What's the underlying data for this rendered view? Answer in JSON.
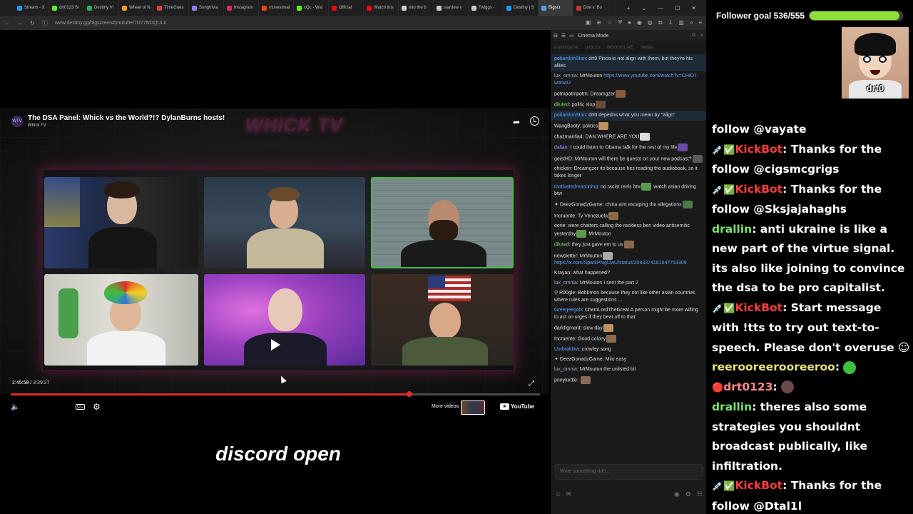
{
  "tabs": [
    {
      "label": "Stream - X",
      "color": "#1d9bf0"
    },
    {
      "label": "drt0123 St",
      "color": "#53fc18"
    },
    {
      "label": "Destiny Vi",
      "color": "#1db954"
    },
    {
      "label": "Wheel of N",
      "color": "#f0a020"
    },
    {
      "label": "TimeGues",
      "color": "#e04040"
    },
    {
      "label": "Songtrivia",
      "color": "#8a7fff"
    },
    {
      "label": "Instagram",
      "color": "#d62976"
    },
    {
      "label": "r/Livestreal",
      "color": "#ff4500"
    },
    {
      "label": "xQc - Wat",
      "color": "#53fc18"
    },
    {
      "label": "Official",
      "color": "#ff0000"
    },
    {
      "label": "Watch this",
      "color": "#ff0000"
    },
    {
      "label": "into the b",
      "color": "#cccccc"
    },
    {
      "label": "stardew v",
      "color": "#cccccc"
    },
    {
      "label": "Twiggs -",
      "color": "#cccccc"
    },
    {
      "label": "Destiny | S",
      "color": "#1d9bf0"
    },
    {
      "label": "Bigscr",
      "color": "#5aa0ff"
    },
    {
      "label": "Doe v. Bo",
      "color": "#cc3333"
    }
  ],
  "active_tab_index": 15,
  "address": {
    "url": "www.destiny.gg/bigscreen#youtube/7iJ77NOQULk"
  },
  "video": {
    "title": "The DSA Panel: Whick vs the World?!? DylanBurns hosts!",
    "channel": "Whick TV",
    "channel_avatar_text": "WTV",
    "logo_text": "WHICK TV",
    "time_current": "2:45:58",
    "time_separator": "/",
    "time_total": "3:39:27",
    "progress_fraction": 0.754,
    "more_videos_label": "More videos",
    "youtube_label": "YouTube"
  },
  "subtitle_text": "discord open",
  "chat": {
    "header_label": "Cinema Mode",
    "pinned": [
      "anythingelse",
      "drt0123",
      "MOOOOLIVE",
      "Viebax"
    ],
    "input_placeholder": "Write something drt0...",
    "messages": [
      {
        "user": "potiamkinStan",
        "user_color": "#5aa0ff",
        "text": "drt0 Pisco is not align with them, but they're his allies",
        "highlight": true
      },
      {
        "user": "lux_omnia",
        "user_color": "#9bb0c8",
        "text": "MrMouton",
        "link": "https://www.youtube.com/watch?v=CHID7-wdowU"
      },
      {
        "user": "potmpotmpotm",
        "user_color": "#ddd",
        "text": "Dreamgzer",
        "emote": "#8a5a3a"
      },
      {
        "user": "diluted",
        "user_color": "#7de06a",
        "text": "politic slop",
        "emote": "#6a4a3a"
      },
      {
        "user": "potiamkinStan",
        "user_color": "#5aa0ff",
        "text": "drt0 depedns what you mean by \"align\"",
        "highlight": true
      },
      {
        "user": "WangBooty",
        "user_color": "#ddd",
        "text": "politics",
        "emote": "#c09060"
      },
      {
        "user": "chazmantia4",
        "user_color": "#ddd",
        "text": "DAN WHERE ARE YOU",
        "emote": "#dddddd"
      },
      {
        "user": "dalian",
        "user_color": "#b08aff",
        "text": "I could listen to Obama talk for the rest of my life",
        "emote": "#6a4aaa"
      },
      {
        "user": "geistHD",
        "user_color": "#ddd",
        "text": "MrMouton will there be guests on your new podcast?",
        "emote": "#5a5a5a"
      },
      {
        "user": "chicken",
        "user_color": "#ddd",
        "text": "Dreamgzer its because hes reading the audiobook, so it takes longer"
      },
      {
        "user": "motivatedreasoning",
        "user_color": "#5aa0ff",
        "text": "no racist reels btw",
        "emote": "#5a9a4a",
        "text2": "watch asian driving btw"
      },
      {
        "user": "DeezGonadzGame",
        "user_color": "#ddd",
        "text": "china aint escaping the allegations",
        "emote": "#4a7a4a",
        "badge": "✦"
      },
      {
        "user": "Incruente",
        "user_color": "#ddd",
        "text": "Ty Venezuela",
        "emote": "#8a6a4a"
      },
      {
        "user": "eerie",
        "user_color": "#ddd",
        "text": "were chatters calling the reckless ben video antisemitic yesterday",
        "emote": "#5a9a4a",
        "text2": "MrMouton"
      },
      {
        "user": "diluted",
        "user_color": "#7de06a",
        "text": "they just gave em to us",
        "emote": "#8a6a4a"
      },
      {
        "user": "newsletter",
        "user_color": "#ddd",
        "text": "MrMouton",
        "emote": "#aaaaaa",
        "link": "https://x.com/SparkPlugUwU/status/2093374181647753309"
      },
      {
        "user": "Krayan",
        "user_color": "#ddd",
        "text": "what happened?"
      },
      {
        "user": "lux_omnia",
        "user_color": "#9bb0c8",
        "text": "MrMouton I sent the part 2"
      },
      {
        "user": "R00gle",
        "user_color": "#ddd",
        "text": "Bobbmon because they not like other asian countries where rules are suggestions ...",
        "badge": "⚲"
      },
      {
        "user": "Greegeegob",
        "user_color": "#5aa0ff",
        "text": "ChemLordTheGreat A person might be more willing to act on urges if they beat off to that"
      },
      {
        "user": "darkfigment",
        "user_color": "#ddd",
        "text": "slow day",
        "emote": "#c09060"
      },
      {
        "user": "Incruente",
        "user_color": "#ddd",
        "text": "Good colony",
        "emote": "#8a6a4a"
      },
      {
        "user": "Umbraklaw",
        "user_color": "#5aa0ff",
        "text": "crowley song"
      },
      {
        "user": "DeezGonadzGame",
        "user_color": "#ddd",
        "text": "Milo easy",
        "badge": "✦"
      },
      {
        "user": "lux_omnia",
        "user_color": "#9bb0c8",
        "text": "MrMouton the unlisted bit"
      },
      {
        "user": "pnnykettle",
        "user_color": "#ddd",
        "text": "",
        "emote": "#8a6a5a"
      }
    ]
  },
  "overlay": {
    "goal_label": "Follower goal 536/555",
    "goal_current": 536,
    "goal_target": 555,
    "goal_color": "#8de03a",
    "webcam_label": "drt0",
    "lines": [
      {
        "badge": "",
        "user": "",
        "text": "follow @vayate"
      },
      {
        "badge": "💉✅",
        "user": "KickBot",
        "user_class": "bot",
        "text": "Thanks for the follow @cigsmcgrigs"
      },
      {
        "badge": "💉✅",
        "user": "KickBot",
        "user_class": "bot",
        "text": "Thanks for the follow @Sksjajahaghs"
      },
      {
        "badge": "",
        "user": "drallin",
        "user_class": "u-green",
        "text": "anti ukraine is like a new part of the virtue signal. its also like joining to convince the dsa to be pro capitalist."
      },
      {
        "badge": "💉✅",
        "user": "KickBot",
        "user_class": "bot",
        "text": "Start message with !tts to try out text-to-speech. Please don't overuse ☺"
      },
      {
        "badge": "",
        "user": "reerooreerooreeroo",
        "user_class": "u-yellow",
        "text": "",
        "emote": "#3fbf3f"
      },
      {
        "badge": "🔴",
        "user": "drt0123",
        "user_class": "u-pink",
        "text": "",
        "emote": "#6a4a4a"
      },
      {
        "badge": "",
        "user": "drallin",
        "user_class": "u-green",
        "text": "theres also some strategies you shouldnt broadcast publically, like infiltration."
      },
      {
        "badge": "💉✅",
        "user": "KickBot",
        "user_class": "bot",
        "text": "Thanks for the follow @Dtal1l"
      }
    ]
  }
}
